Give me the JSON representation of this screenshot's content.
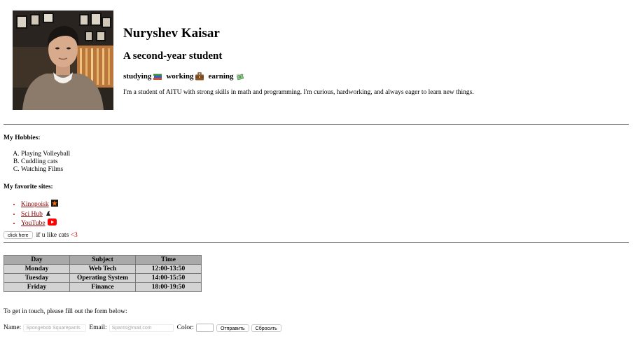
{
  "profile": {
    "name": "Nuryshev Kaisar",
    "subtitle": "A second-year student",
    "tagline": [
      "studying",
      "working",
      "earning"
    ],
    "bio": "I'm a student of AITU with strong skills in math and programming. I'm curious, hardworking, and always eager to learn new things."
  },
  "hobbies": {
    "title": "My Hobbies:",
    "items": [
      "Playing Volleyball",
      "Cuddling cats",
      "Watching Films"
    ]
  },
  "sites": {
    "title": "My favorite sites:",
    "items": [
      {
        "label": "Kinopoisk",
        "icon": "clapperboard-icon"
      },
      {
        "label": "Sci Hub",
        "icon": "raven-icon"
      },
      {
        "label": "YouTube",
        "icon": "youtube-icon"
      }
    ]
  },
  "cats": {
    "button_label": "click here",
    "text": "if u like cats",
    "heart": "<3"
  },
  "schedule": {
    "headers": [
      "Day",
      "Subject",
      "Time"
    ],
    "rows": [
      [
        "Monday",
        "Web Tech",
        "12:00-13:50"
      ],
      [
        "Tuesday",
        "Operating System",
        "14:00-15:50"
      ],
      [
        "Friday",
        "Finance",
        "18:00-19:50"
      ]
    ]
  },
  "contact": {
    "intro": "To get in touch, please fill out the form below:",
    "name_label": "Name:",
    "name_placeholder": "Spongebob Squarepants",
    "email_label": "Email:",
    "email_placeholder": "Spants@mail.com",
    "color_label": "Color:",
    "color_value": "#ffffff",
    "submit_label": "Отправить",
    "reset_label": "Сбросить"
  },
  "colors": {
    "link": "#8b0000",
    "table_header_bg": "#a9a9a9",
    "table_cell_bg": "#d3d3d3",
    "heart": "#c00000"
  }
}
